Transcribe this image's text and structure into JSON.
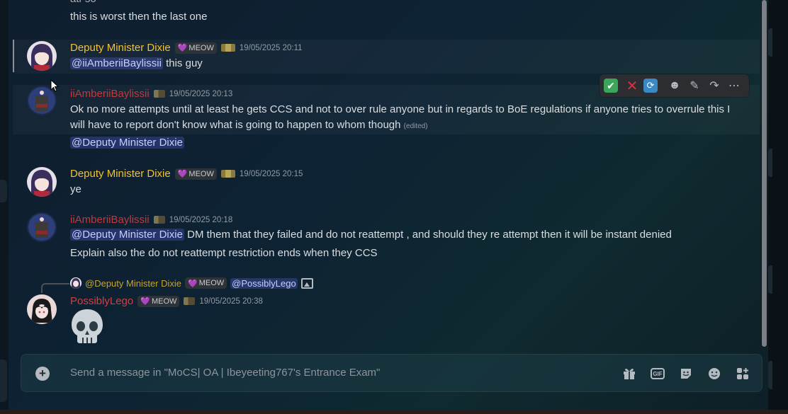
{
  "channel": {
    "placeholder": "Send a message in \"MoCS| OA | Ibeyeeting767's Entrance Exam\""
  },
  "messages": [
    {
      "lines": [
        "ati-so",
        "this is worst then the last one"
      ]
    },
    {
      "author": "Deputy Minister Dixie",
      "tag": "MEOW",
      "timestamp": "19/05/2025 20:11",
      "mention": "@iiAmberiiBaylissii",
      "text": "this guy"
    },
    {
      "author": "iiAmberiiBaylissii",
      "timestamp": "19/05/2025 20:13",
      "text": "Ok no more attempts until at least he gets CCS and not to over rule anyone but in regards to BoE regulations if anyone tries to overrule this I will have to report don't know what is going to happen to whom though",
      "edited": "(edited)",
      "mention": "@Deputy Minister Dixie"
    },
    {
      "author": "Deputy Minister Dixie",
      "tag": "MEOW",
      "timestamp": "19/05/2025 20:15",
      "text": "ye"
    },
    {
      "author": "iiAmberiiBaylissii",
      "timestamp": "19/05/2025 20:18",
      "mention": "@Deputy Minister Dixie",
      "text": "DM them that they failed and do not reattempt , and should they re attempt then it will be instant denied",
      "text2": "Explain also the do not reattempt restriction ends when they CCS"
    },
    {
      "reply_to": {
        "author": "@Deputy Minister Dixie",
        "tag": "MEOW",
        "mention": "@PossiblyLego"
      },
      "author": "PossiblyLego",
      "tag": "MEOW",
      "timestamp": "19/05/2025 20:38",
      "emoji": "skull"
    }
  ],
  "hover_toolbar": {
    "icons": [
      "check-mark-reaction",
      "cross-mark-reaction",
      "repeat-reaction",
      "add-reaction",
      "edit",
      "forward",
      "more"
    ]
  },
  "composer_icons": [
    "gift",
    "gif",
    "sticker",
    "emoji",
    "apps"
  ],
  "colors": {
    "author_gold": "#f0c233",
    "author_red": "#c0393c",
    "mention_bg": "#5865f2"
  }
}
